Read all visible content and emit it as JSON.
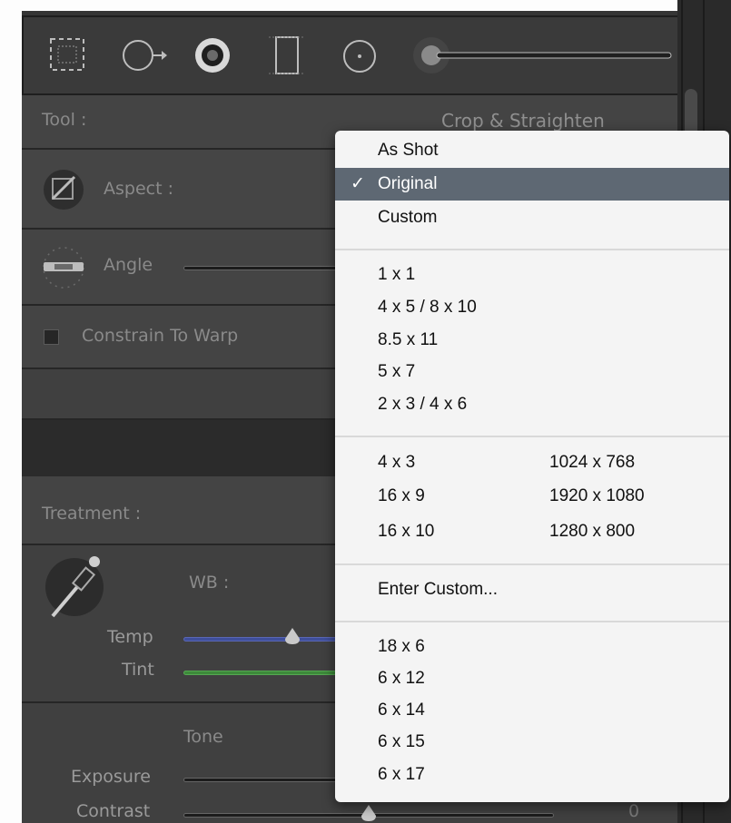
{
  "tool_row": {
    "label": "Tool :",
    "value": "Crop & Straighten"
  },
  "aspect": {
    "label": "Aspect :"
  },
  "angle": {
    "label": "Angle"
  },
  "constrain": {
    "label": "Constrain To Warp",
    "checked": false
  },
  "treatment": {
    "label": "Treatment :"
  },
  "wb": {
    "label": "WB :"
  },
  "temp": {
    "label": "Temp"
  },
  "tint": {
    "label": "Tint"
  },
  "tone": {
    "label": "Tone"
  },
  "exposure": {
    "label": "Exposure"
  },
  "contrast": {
    "label": "Contrast",
    "value": "0"
  },
  "icons": [
    "crop-overlay-icon",
    "spot-removal-icon",
    "red-eye-icon",
    "graduated-filter-icon",
    "radial-filter-icon",
    "adjustment-brush-icon"
  ],
  "menu": {
    "check_mark": "✓",
    "group1": [
      "As Shot",
      "Original",
      "Custom"
    ],
    "selected": "Original",
    "group2": [
      "1 x 1",
      "4 x 5  /  8 x 10",
      "8.5 x 11",
      "5 x 7",
      "2 x 3  /  4 x 6"
    ],
    "group3": [
      {
        "ratio": "4 x 3",
        "res": "1024 x 768"
      },
      {
        "ratio": "16 x 9",
        "res": "1920 x 1080"
      },
      {
        "ratio": "16 x 10",
        "res": "1280 x 800"
      }
    ],
    "enter_custom": "Enter Custom...",
    "group4": [
      "18 x 6",
      "6 x 12",
      "6 x 14",
      "6 x 15",
      "6 x 17"
    ]
  }
}
